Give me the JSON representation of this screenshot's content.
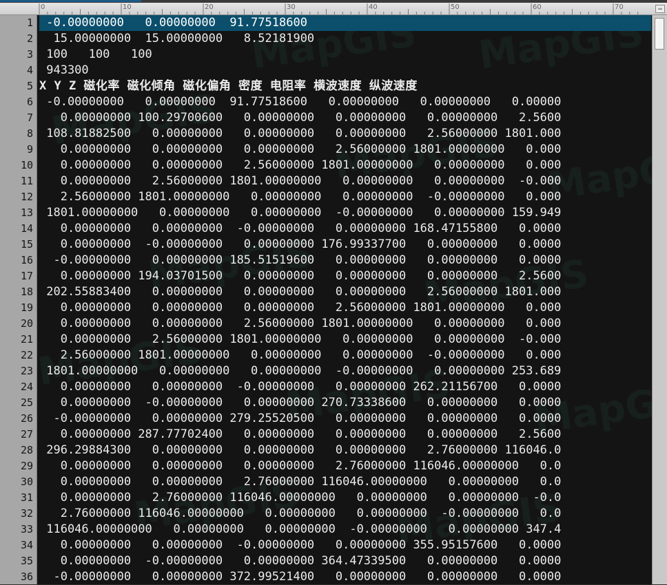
{
  "ruler": {
    "marks": [
      "0",
      "10",
      "20",
      "30",
      "40",
      "50",
      "60",
      "70"
    ]
  },
  "watermark_text": "MapGIS",
  "accent_colors": {
    "selection": "#0b4f6c",
    "editor_bg": "#141414",
    "gutter_bg": "#a7a7a7"
  },
  "selected_line": 1,
  "header_line": 5,
  "lines": [
    {
      "n": "1",
      "t": " -0.00000000   0.00000000  91.77518600"
    },
    {
      "n": "2",
      "t": "  15.00000000  15.00000000   8.52181900"
    },
    {
      "n": "3",
      "t": " 100   100   100"
    },
    {
      "n": "4",
      "t": " 943300"
    },
    {
      "n": "5",
      "t": "X Y Z 磁化率 磁化倾角 磁化偏角 密度 电阻率 横波速度 纵波速度"
    },
    {
      "n": "6",
      "t": " -0.00000000   0.00000000  91.77518600   0.00000000   0.00000000   0.00000"
    },
    {
      "n": "7",
      "t": "   0.00000000 100.29700600   0.00000000   0.00000000   0.00000000   2.5600"
    },
    {
      "n": "8",
      "t": " 108.81882500   0.00000000   0.00000000   0.00000000   2.56000000 1801.000"
    },
    {
      "n": "9",
      "t": "   0.00000000   0.00000000   0.00000000   2.56000000 1801.00000000   0.000"
    },
    {
      "n": "10",
      "t": "   0.00000000   0.00000000   2.56000000 1801.00000000   0.00000000   0.000"
    },
    {
      "n": "11",
      "t": "   0.00000000   2.56000000 1801.00000000   0.00000000   0.00000000  -0.000"
    },
    {
      "n": "12",
      "t": "   2.56000000 1801.00000000   0.00000000   0.00000000  -0.00000000   0.000"
    },
    {
      "n": "13",
      "t": " 1801.00000000   0.00000000   0.00000000  -0.00000000   0.00000000 159.949"
    },
    {
      "n": "14",
      "t": "   0.00000000   0.00000000  -0.00000000   0.00000000 168.47155800   0.0000"
    },
    {
      "n": "15",
      "t": "   0.00000000  -0.00000000   0.00000000 176.99337700   0.00000000   0.0000"
    },
    {
      "n": "16",
      "t": "  -0.00000000   0.00000000 185.51519600   0.00000000   0.00000000   0.0000"
    },
    {
      "n": "17",
      "t": "   0.00000000 194.03701500   0.00000000   0.00000000   0.00000000   2.5600"
    },
    {
      "n": "18",
      "t": " 202.55883400   0.00000000   0.00000000   0.00000000   2.56000000 1801.000"
    },
    {
      "n": "19",
      "t": "   0.00000000   0.00000000   0.00000000   2.56000000 1801.00000000   0.000"
    },
    {
      "n": "20",
      "t": "   0.00000000   0.00000000   2.56000000 1801.00000000   0.00000000   0.000"
    },
    {
      "n": "21",
      "t": "   0.00000000   2.56000000 1801.00000000   0.00000000   0.00000000  -0.000"
    },
    {
      "n": "22",
      "t": "   2.56000000 1801.00000000   0.00000000   0.00000000  -0.00000000   0.000"
    },
    {
      "n": "23",
      "t": " 1801.00000000   0.00000000   0.00000000  -0.00000000   0.00000000 253.689"
    },
    {
      "n": "24",
      "t": "   0.00000000   0.00000000  -0.00000000   0.00000000 262.21156700   0.0000"
    },
    {
      "n": "25",
      "t": "   0.00000000  -0.00000000   0.00000000 270.73338600   0.00000000   0.0000"
    },
    {
      "n": "26",
      "t": "  -0.00000000   0.00000000 279.25520500   0.00000000   0.00000000   0.0000"
    },
    {
      "n": "27",
      "t": "   0.00000000 287.77702400   0.00000000   0.00000000   0.00000000   2.5600"
    },
    {
      "n": "28",
      "t": " 296.29884300   0.00000000   0.00000000   0.00000000   2.76000000 116046.0"
    },
    {
      "n": "29",
      "t": "   0.00000000   0.00000000   0.00000000   2.76000000 116046.00000000   0.0"
    },
    {
      "n": "30",
      "t": "   0.00000000   0.00000000   2.76000000 116046.00000000   0.00000000   0.0"
    },
    {
      "n": "31",
      "t": "   0.00000000   2.76000000 116046.00000000   0.00000000   0.00000000  -0.0"
    },
    {
      "n": "32",
      "t": "   2.76000000 116046.00000000   0.00000000   0.00000000  -0.00000000   0.0"
    },
    {
      "n": "33",
      "t": " 116046.00000000   0.00000000   0.00000000  -0.00000000   0.00000000 347.4"
    },
    {
      "n": "34",
      "t": "   0.00000000   0.00000000  -0.00000000   0.00000000 355.95157600   0.0000"
    },
    {
      "n": "35",
      "t": "   0.00000000  -0.00000000   0.00000000 364.47339500   0.00000000   0.0000"
    },
    {
      "n": "36",
      "t": "  -0.00000000   0.00000000 372.99521400   0.00000000   0.00000000   0.0000"
    }
  ]
}
